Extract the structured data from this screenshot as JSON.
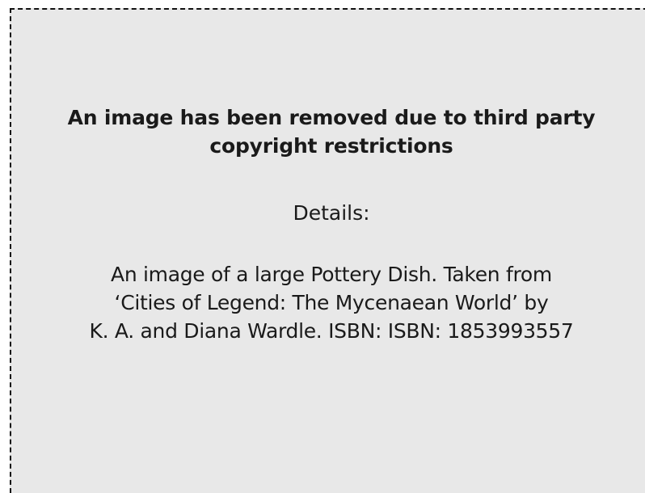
{
  "notice": {
    "title_line1": "An image has been removed due to third party",
    "title_line2": "copyright restrictions",
    "details_label": "Details:",
    "description_line1": "An image of a large Pottery Dish. Taken from",
    "description_line2": "‘Cities of Legend: The Mycenaean World’ by",
    "description_line3": "K. A. and Diana Wardle. ISBN: ISBN: 1853993557"
  },
  "colors": {
    "background": "#e8e8e8",
    "border": "#111111",
    "text": "#1a1a1a"
  }
}
